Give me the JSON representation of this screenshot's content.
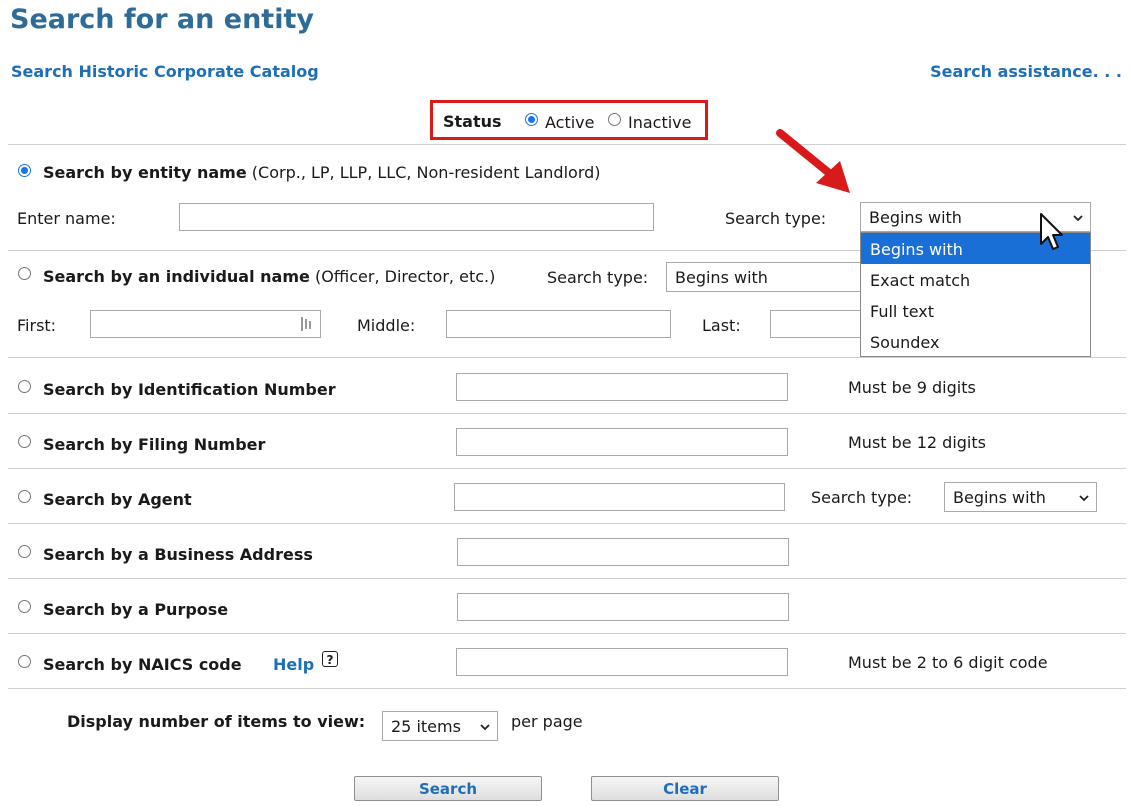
{
  "page": {
    "title": "Search for an entity",
    "historic_link": "Search Historic Corporate Catalog",
    "assist_link": "Search assistance. . ."
  },
  "status": {
    "label": "Status",
    "options": [
      "Active",
      "Inactive"
    ],
    "selected": "Active"
  },
  "entity_name": {
    "label": "Search by entity name",
    "note": "(Corp., LP, LLP, LLC, Non-resident Landlord)",
    "enter_label": "Enter name:",
    "search_type_label": "Search type:",
    "search_type_value": "Begins with",
    "dropdown_options": [
      "Begins with",
      "Exact match",
      "Full text",
      "Soundex"
    ],
    "dropdown_highlighted": "Begins with"
  },
  "individual": {
    "label": "Search by an individual name",
    "note": "(Officer, Director, etc.)",
    "search_type_label": "Search type:",
    "search_type_value": "Begins with",
    "first_label": "First:",
    "middle_label": "Middle:",
    "last_label": "Last:"
  },
  "id_number": {
    "label": "Search by Identification Number",
    "hint": "Must be 9 digits"
  },
  "filing": {
    "label": "Search by Filing Number",
    "hint": "Must be 12 digits"
  },
  "agent": {
    "label": "Search by Agent",
    "search_type_label": "Search type:",
    "search_type_value": "Begins with"
  },
  "address": {
    "label": "Search by a Business Address"
  },
  "purpose": {
    "label": "Search by a Purpose"
  },
  "naics": {
    "label": "Search by NAICS code",
    "help": "Help",
    "hint": "Must be 2 to 6 digit code"
  },
  "display": {
    "label": "Display number of items to view:",
    "value": "25 items",
    "suffix": "per page"
  },
  "buttons": {
    "search": "Search",
    "clear": "Clear"
  },
  "colors": {
    "accent": "#1a73e8",
    "link": "#1e6fb8",
    "title": "#2e6b96",
    "annotation": "#d81a1a"
  }
}
